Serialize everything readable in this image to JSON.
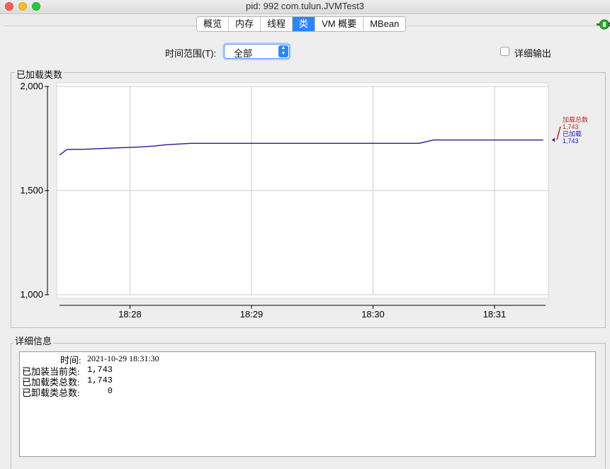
{
  "window": {
    "title": "pid: 992 com.tulun.JVMTest3"
  },
  "tabs": [
    {
      "label": "概览",
      "active": false
    },
    {
      "label": "内存",
      "active": false
    },
    {
      "label": "线程",
      "active": false
    },
    {
      "label": "类",
      "active": true
    },
    {
      "label": "VM 概要",
      "active": false
    },
    {
      "label": "MBean",
      "active": false
    }
  ],
  "controls": {
    "time_range_label": "时间范围(T):",
    "time_range_value": "全部",
    "verbose_label": "详细输出",
    "verbose_checked": false
  },
  "chart_panel": {
    "title": "已加载类数"
  },
  "chart_data": {
    "type": "line",
    "ylim": [
      1000,
      2000
    ],
    "yticks": [
      1000,
      1500,
      2000
    ],
    "ytick_labels": [
      "1,000",
      "1,500",
      "2,000"
    ],
    "xtick_labels": [
      "18:28",
      "18:29",
      "18:30",
      "18:31"
    ],
    "x_minutes_from_1827": {
      "range": [
        0.42,
        4.42
      ],
      "ticks": [
        1,
        2,
        3,
        4
      ]
    },
    "series": [
      {
        "name": "加载总数",
        "color": "#c0272d",
        "value_label": "1,743",
        "points": [
          [
            0.42,
            1670
          ],
          [
            0.48,
            1697
          ],
          [
            0.55,
            1698
          ],
          [
            0.6,
            1698
          ],
          [
            0.7,
            1700
          ],
          [
            0.85,
            1704
          ],
          [
            1.0,
            1707
          ],
          [
            1.1,
            1710
          ],
          [
            1.2,
            1714
          ],
          [
            1.3,
            1720
          ],
          [
            1.45,
            1725
          ],
          [
            1.5,
            1727
          ],
          [
            2.0,
            1727
          ],
          [
            2.5,
            1727
          ],
          [
            3.0,
            1727
          ],
          [
            3.38,
            1727
          ],
          [
            3.5,
            1743
          ],
          [
            4.0,
            1743
          ],
          [
            4.4,
            1743
          ]
        ]
      },
      {
        "name": "已加载",
        "color": "#1a1ab0",
        "value_label": "1,743",
        "points": [
          [
            0.42,
            1670
          ],
          [
            0.48,
            1697
          ],
          [
            0.55,
            1698
          ],
          [
            0.6,
            1698
          ],
          [
            0.7,
            1700
          ],
          [
            0.85,
            1704
          ],
          [
            1.0,
            1707
          ],
          [
            1.1,
            1710
          ],
          [
            1.2,
            1714
          ],
          [
            1.3,
            1720
          ],
          [
            1.45,
            1725
          ],
          [
            1.5,
            1727
          ],
          [
            2.0,
            1727
          ],
          [
            2.5,
            1727
          ],
          [
            3.0,
            1727
          ],
          [
            3.38,
            1727
          ],
          [
            3.5,
            1743
          ],
          [
            4.0,
            1743
          ],
          [
            4.4,
            1743
          ]
        ]
      }
    ]
  },
  "details": {
    "title": "详细信息",
    "rows": [
      {
        "label": "时间:",
        "value": "2021-10-29 18:31:30"
      },
      {
        "label": "已加装当前类:",
        "value": "1,743"
      },
      {
        "label": "已加载类总数:",
        "value": "1,743"
      },
      {
        "label": "已卸载类总数:",
        "value": "    0"
      }
    ]
  }
}
